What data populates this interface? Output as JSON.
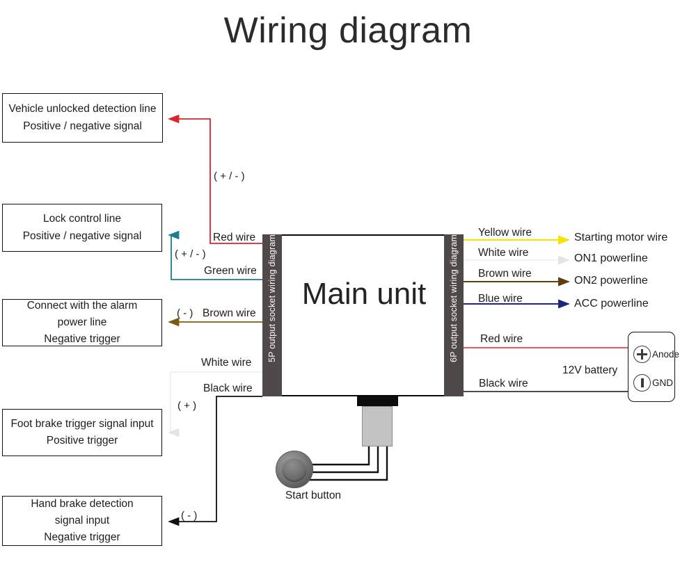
{
  "title": "Wiring diagram",
  "main_unit": {
    "label": "Main unit",
    "socket_left": "5P output socket wiring diagram",
    "socket_right": "6P output socket wiring diagram"
  },
  "start_button": {
    "label": "Start button"
  },
  "battery": {
    "label": "12V battery",
    "anode_label": "Anode",
    "gnd_label": "GND"
  },
  "left_callouts": [
    {
      "id": "vehicle-unlocked",
      "line1": "Vehicle unlocked detection line",
      "line2": "Positive / negative signal"
    },
    {
      "id": "lock-control",
      "line1": "Lock control line",
      "line2": "Positive / negative signal"
    },
    {
      "id": "alarm-power",
      "line1": "Connect with the alarm",
      "line2": "power line",
      "line3": "Negative trigger"
    },
    {
      "id": "foot-brake",
      "line1": "Foot brake trigger signal input",
      "line2": "Positive trigger"
    },
    {
      "id": "hand-brake",
      "line1": "Hand brake detection",
      "line2": "signal input",
      "line3": "Negative trigger"
    }
  ],
  "left_wires": [
    {
      "name": "Red wire",
      "color": "#d9232e",
      "polarity": "( + / - )"
    },
    {
      "name": "Green wire",
      "color": "#1a7f8e",
      "polarity": "( + / - )"
    },
    {
      "name": "Brown wire",
      "color": "#7a5b16",
      "polarity": "( - )"
    },
    {
      "name": "White wire",
      "color": "#efefef",
      "polarity": "( + )"
    },
    {
      "name": "Black wire",
      "color": "#111111",
      "polarity": "( - )"
    }
  ],
  "right_wires": [
    {
      "name": "Yellow wire",
      "color": "#f5e400",
      "destination": "Starting motor wire"
    },
    {
      "name": "White wire",
      "color": "#f2f2f2",
      "destination": "ON1 powerline"
    },
    {
      "name": "Brown wire",
      "color": "#5e3c0c",
      "destination": "ON2 powerline"
    },
    {
      "name": "Blue wire",
      "color": "#1b2878",
      "destination": "ACC powerline"
    },
    {
      "name": "Red wire",
      "color": "#d9232e",
      "destination": ""
    },
    {
      "name": "Black wire",
      "color": "#111111",
      "destination": ""
    }
  ],
  "colors": {
    "box_border": "#101010",
    "socket_strip": "#4f4a49",
    "background": "#ffffff",
    "text": "#1c1c1c"
  }
}
